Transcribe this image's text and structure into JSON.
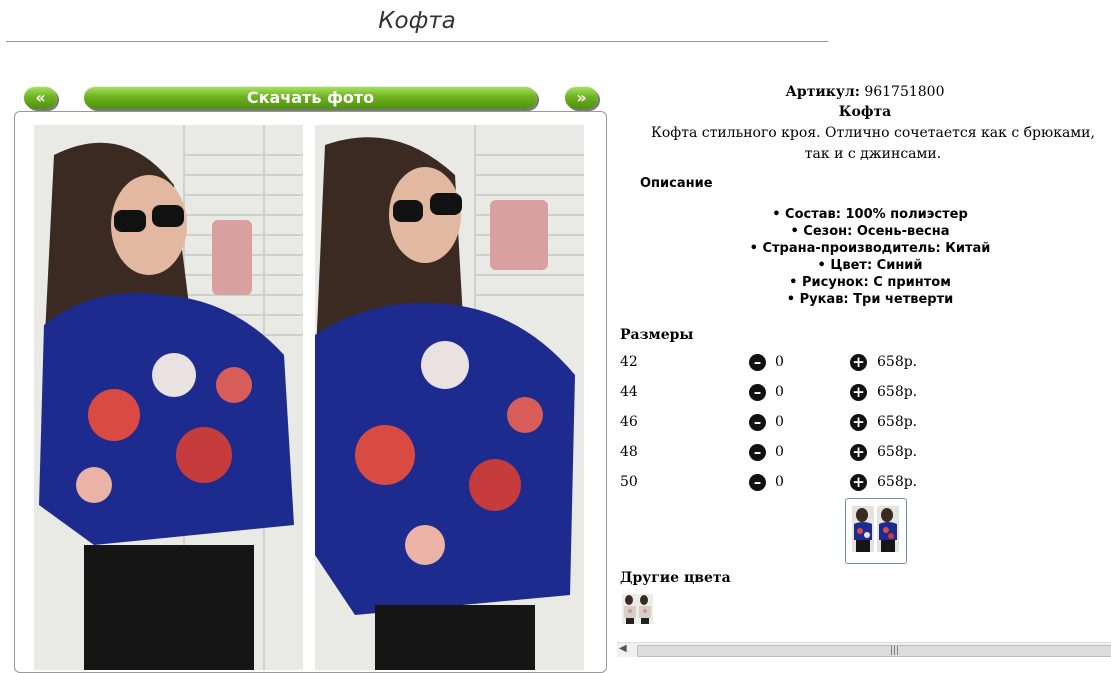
{
  "header": {
    "title": "Кофта"
  },
  "nav": {
    "prev_label": "«",
    "download_label": "Скачать фото",
    "next_label": "»"
  },
  "product": {
    "article_label": "Артикул:",
    "article_value": "961751800",
    "name": "Кофта",
    "description": "Кофта стильного кроя. Отлично сочетается как с брюками, так и с джинсами.",
    "details_heading": "Описание",
    "properties": [
      "Состав: 100% полиэстер",
      "Сезон: Осень-весна",
      "Страна-производитель: Китай",
      "Цвет: Синий",
      "Рисунок: С принтом",
      "Рукав: Три четверти"
    ]
  },
  "sizes": {
    "heading": "Размеры",
    "rows": [
      {
        "size": "42",
        "qty": "0",
        "price": "658р."
      },
      {
        "size": "44",
        "qty": "0",
        "price": "658р."
      },
      {
        "size": "46",
        "qty": "0",
        "price": "658р."
      },
      {
        "size": "48",
        "qty": "0",
        "price": "658р."
      },
      {
        "size": "50",
        "qty": "0",
        "price": "658р."
      }
    ]
  },
  "colors": {
    "heading": "Другие цвета"
  },
  "icons": {
    "minus": "minus-circle-icon",
    "plus": "plus-circle-icon"
  },
  "theme": {
    "accent": "#6fb21f",
    "frame_border": "#999999"
  }
}
